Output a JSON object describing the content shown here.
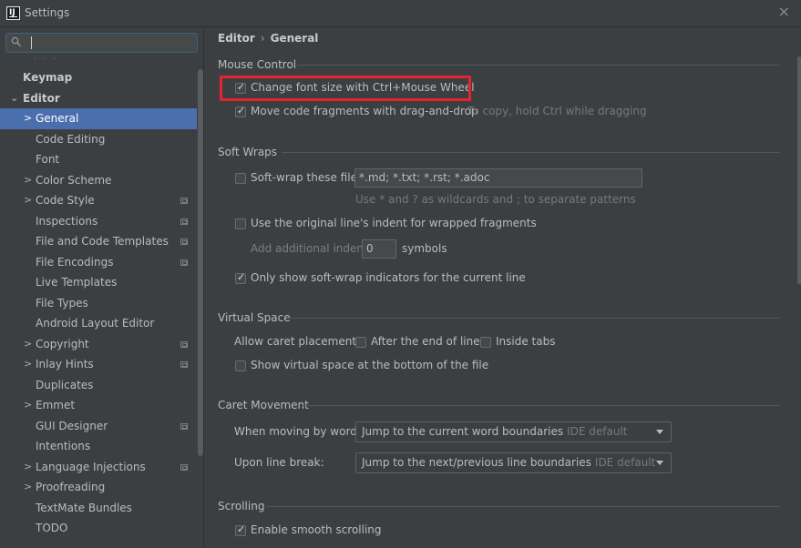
{
  "window": {
    "title": "Settings",
    "close_glyph": "×"
  },
  "search": {
    "placeholder": ""
  },
  "sidebar": {
    "items": [
      {
        "label": "Keymap",
        "bold": true,
        "indent": 0,
        "arrow": "",
        "proj": false
      },
      {
        "label": "Editor",
        "bold": true,
        "indent": 0,
        "arrow": "⌄",
        "proj": false
      },
      {
        "label": "General",
        "bold": false,
        "indent": 1,
        "arrow": ">",
        "proj": false,
        "selected": true
      },
      {
        "label": "Code Editing",
        "bold": false,
        "indent": 1,
        "arrow": "",
        "proj": false
      },
      {
        "label": "Font",
        "bold": false,
        "indent": 1,
        "arrow": "",
        "proj": false
      },
      {
        "label": "Color Scheme",
        "bold": false,
        "indent": 1,
        "arrow": ">",
        "proj": false
      },
      {
        "label": "Code Style",
        "bold": false,
        "indent": 1,
        "arrow": ">",
        "proj": true
      },
      {
        "label": "Inspections",
        "bold": false,
        "indent": 1,
        "arrow": "",
        "proj": true
      },
      {
        "label": "File and Code Templates",
        "bold": false,
        "indent": 1,
        "arrow": "",
        "proj": true
      },
      {
        "label": "File Encodings",
        "bold": false,
        "indent": 1,
        "arrow": "",
        "proj": true
      },
      {
        "label": "Live Templates",
        "bold": false,
        "indent": 1,
        "arrow": "",
        "proj": false
      },
      {
        "label": "File Types",
        "bold": false,
        "indent": 1,
        "arrow": "",
        "proj": false
      },
      {
        "label": "Android Layout Editor",
        "bold": false,
        "indent": 1,
        "arrow": "",
        "proj": false
      },
      {
        "label": "Copyright",
        "bold": false,
        "indent": 1,
        "arrow": ">",
        "proj": true
      },
      {
        "label": "Inlay Hints",
        "bold": false,
        "indent": 1,
        "arrow": ">",
        "proj": true
      },
      {
        "label": "Duplicates",
        "bold": false,
        "indent": 1,
        "arrow": "",
        "proj": false
      },
      {
        "label": "Emmet",
        "bold": false,
        "indent": 1,
        "arrow": ">",
        "proj": false
      },
      {
        "label": "GUI Designer",
        "bold": false,
        "indent": 1,
        "arrow": "",
        "proj": true
      },
      {
        "label": "Intentions",
        "bold": false,
        "indent": 1,
        "arrow": "",
        "proj": false
      },
      {
        "label": "Language Injections",
        "bold": false,
        "indent": 1,
        "arrow": ">",
        "proj": true
      },
      {
        "label": "Proofreading",
        "bold": false,
        "indent": 1,
        "arrow": ">",
        "proj": false
      },
      {
        "label": "TextMate Bundles",
        "bold": false,
        "indent": 1,
        "arrow": "",
        "proj": false
      },
      {
        "label": "TODO",
        "bold": false,
        "indent": 1,
        "arrow": "",
        "proj": false
      }
    ]
  },
  "breadcrumb": {
    "parent": "Editor",
    "sep": "›",
    "current": "General"
  },
  "mouse_control": {
    "title": "Mouse Control",
    "change_font": {
      "label": "Change font size with Ctrl+Mouse Wheel",
      "checked": true
    },
    "move_fragments": {
      "label": "Move code fragments with drag-and-drop",
      "checked": true,
      "hint": "To copy, hold Ctrl while dragging"
    }
  },
  "soft_wraps": {
    "title": "Soft Wraps",
    "soft_wrap_files": {
      "label": "Soft-wrap these files:",
      "checked": false,
      "value": "*.md; *.txt; *.rst; *.adoc"
    },
    "patterns_hint": "Use * and ? as wildcards and ; to separate patterns",
    "original_indent": {
      "label": "Use the original line's indent for wrapped fragments",
      "checked": false
    },
    "additional_indent": {
      "label": "Add additional indent:",
      "value": "0",
      "unit": "symbols"
    },
    "only_current": {
      "label": "Only show soft-wrap indicators for the current line",
      "checked": true
    }
  },
  "virtual_space": {
    "title": "Virtual Space",
    "caret_label": "Allow caret placement:",
    "after_end": {
      "label": "After the end of line",
      "checked": false
    },
    "inside_tabs": {
      "label": "Inside tabs",
      "checked": false
    },
    "show_bottom": {
      "label": "Show virtual space at the bottom of the file",
      "checked": false
    }
  },
  "caret_movement": {
    "title": "Caret Movement",
    "words": {
      "label": "When moving by words:",
      "value": "Jump to the current word boundaries",
      "extra": "IDE default"
    },
    "line_break": {
      "label": "Upon line break:",
      "value": "Jump to the next/previous line boundaries",
      "extra": "IDE default"
    }
  },
  "scrolling": {
    "title": "Scrolling",
    "smooth": {
      "label": "Enable smooth scrolling",
      "checked": true
    }
  }
}
